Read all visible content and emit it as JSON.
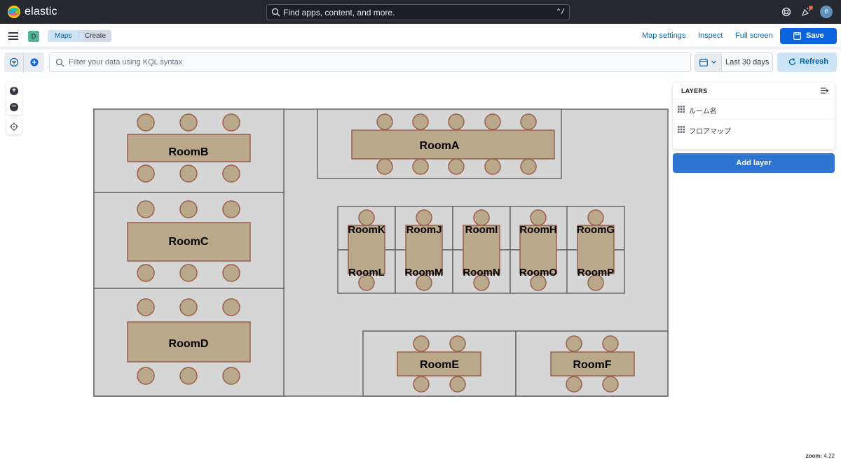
{
  "header": {
    "brand": "elastic",
    "search_placeholder": "Find apps, content, and more.",
    "search_shortcut": "⌃/",
    "user_initial": "e"
  },
  "nav": {
    "space_initial": "D",
    "breadcrumbs": [
      "Maps",
      "Create"
    ],
    "links": [
      "Map settings",
      "Inspect",
      "Full screen"
    ],
    "save_label": "Save"
  },
  "query": {
    "placeholder": "Filter your data using KQL syntax",
    "date_range": "Last 30 days",
    "refresh_label": "Refresh"
  },
  "layers": {
    "title": "LAYERS",
    "items": [
      {
        "label": "ルーム名"
      },
      {
        "label": "フロアマップ"
      }
    ],
    "add_label": "Add layer"
  },
  "map": {
    "zoom_label": "zoom:",
    "zoom_value": "4.22",
    "rooms": {
      "a": "RoomA",
      "b": "RoomB",
      "c": "RoomC",
      "d": "RoomD",
      "e": "RoomE",
      "f": "RoomF",
      "g": "RoomG",
      "h": "RoomH",
      "i": "RoomI",
      "j": "RoomJ",
      "k": "RoomK",
      "l": "RoomL",
      "m": "RoomM",
      "n": "RoomN",
      "o": "RoomO",
      "p": "RoomP"
    },
    "colors": {
      "floor": "#d6d6d6",
      "wall": "#666666",
      "table": "#b9a88a",
      "table_border": "#9b5f50"
    }
  }
}
